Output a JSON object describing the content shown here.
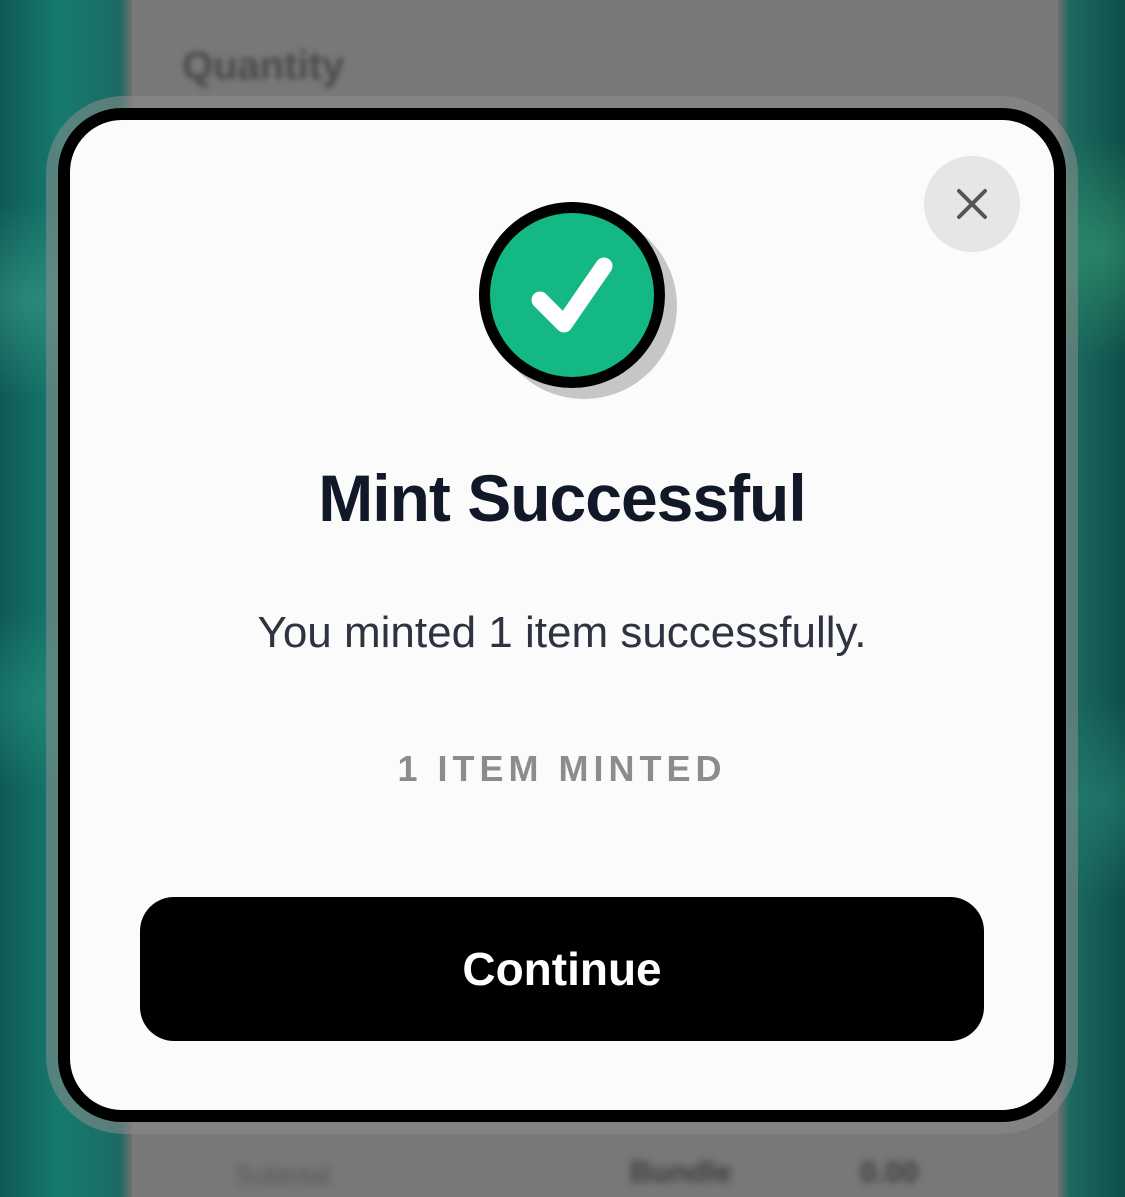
{
  "background": {
    "heading": "Quantity",
    "footer_left": "Subtotal",
    "footer_mid": "Bundle",
    "footer_right": "0.00"
  },
  "modal": {
    "title": "Mint Successful",
    "message": "You minted 1 item successfully.",
    "count_label": "1 ITEM MINTED",
    "continue_label": "Continue",
    "close_icon": "close-icon",
    "status_icon": "checkmark-circle-icon"
  },
  "colors": {
    "success": "#14b885",
    "button": "#000000",
    "title": "#111827"
  }
}
